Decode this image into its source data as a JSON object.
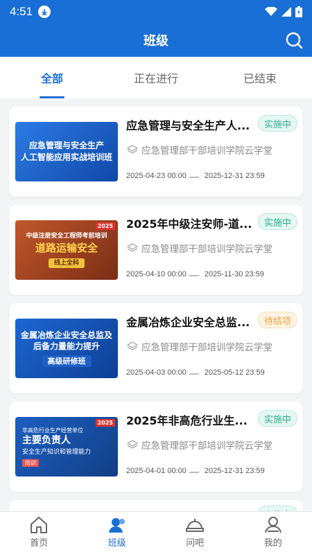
{
  "status": {
    "time": "4:51"
  },
  "header": {
    "title": "班级"
  },
  "tabs": [
    {
      "label": "全部",
      "active": true
    },
    {
      "label": "正在进行",
      "active": false
    },
    {
      "label": "已结束",
      "active": false
    }
  ],
  "courses": [
    {
      "title": "应急管理与安全生产人...",
      "status": "实施中",
      "status_color": "green",
      "org": "应急管理部干部培训学院云学堂",
      "start": "2025-04-23 00:00",
      "end": "2025-12-31 23:59",
      "thumb_lines": [
        "应急管理与安全生产",
        "人工智能应用实战培训班"
      ]
    },
    {
      "title": "2025年中级注安师-道...",
      "status": "实施中",
      "status_color": "green",
      "org": "应急管理部干部培训学院云学堂",
      "start": "2025-04-10 00:00",
      "end": "2025-11-30 23:59",
      "thumb_year": "2025",
      "thumb_lines": [
        "中级注册安全工程师考前培训",
        "道路运输安全",
        "线上全科"
      ]
    },
    {
      "title": "金属冶炼企业安全总监...",
      "status": "待结项",
      "status_color": "orange",
      "org": "应急管理部干部培训学院云学堂",
      "start": "2025-04-03 00:00",
      "end": "2025-05-12 23:59",
      "thumb_lines": [
        "金属冶炼企业安全总监及",
        "后备力量能力提升",
        "高级研修班"
      ]
    },
    {
      "title": "2025年非高危行业生...",
      "status": "实施中",
      "status_color": "green",
      "org": "应急管理部干部培训学院云学堂",
      "start": "2025-04-01 00:00",
      "end": "2025-12-31 23:59",
      "thumb_year": "2025",
      "thumb_lines": [
        "非高危行业生产经营单位",
        "主要负责人",
        "安全生产知识和管理能力",
        "培训"
      ]
    }
  ],
  "partial_card": {
    "status": "实施中"
  },
  "nav": [
    {
      "label": "首页",
      "icon": "home-icon",
      "active": false
    },
    {
      "label": "班级",
      "icon": "class-icon",
      "active": true
    },
    {
      "label": "问吧",
      "icon": "ask-icon",
      "active": false
    },
    {
      "label": "我的",
      "icon": "profile-icon",
      "active": false
    }
  ]
}
